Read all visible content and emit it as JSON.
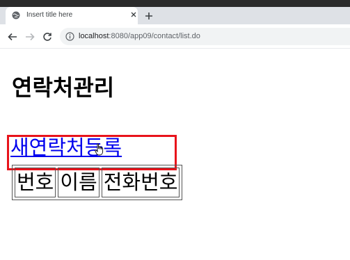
{
  "browser": {
    "tab": {
      "title": "Insert title here"
    },
    "address_bar": {
      "host": "localhost",
      "path": ":8080/app09/contact/list.do"
    }
  },
  "page": {
    "title": "연락처관리",
    "new_contact_link": "새연락처등록",
    "table": {
      "headers": [
        "번호",
        "이름",
        "전화번호"
      ]
    }
  },
  "colors": {
    "link": "#0000ee",
    "highlight": "#e8131b"
  }
}
